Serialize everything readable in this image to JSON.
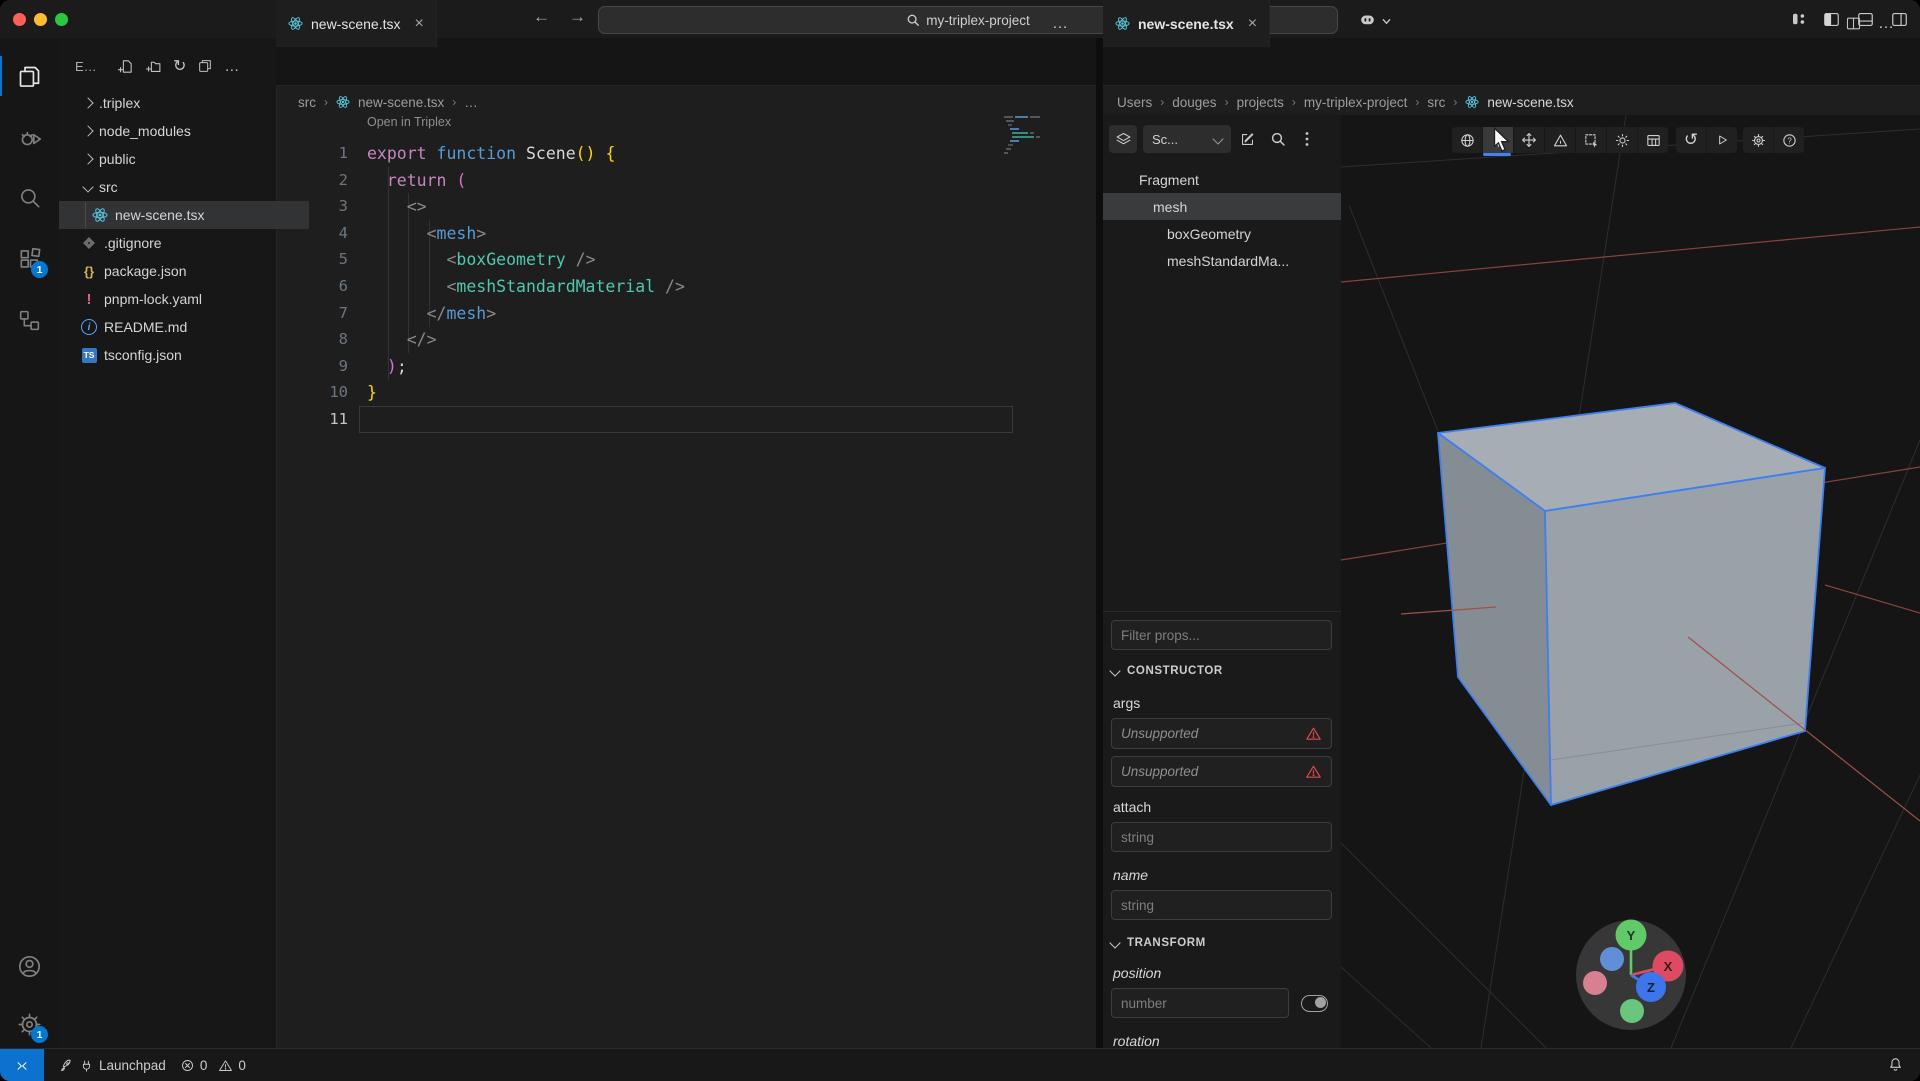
{
  "colors": {
    "accent_blue": "#0078d4",
    "selection_outline": "#3d7ff2",
    "badge_blue": "#0078d4",
    "error_red": "#e5484d",
    "react_cyan": "#58c4dc"
  },
  "titlebar": {
    "project_search": "my-triplex-project"
  },
  "activity_bar": {
    "extensions_badge": "1",
    "settings_badge": "1"
  },
  "explorer": {
    "title": "E…",
    "items": [
      {
        "label": ".triplex"
      },
      {
        "label": "node_modules"
      },
      {
        "label": "public"
      },
      {
        "label": "src"
      },
      {
        "label": "new-scene.tsx"
      },
      {
        "label": ".gitignore"
      },
      {
        "label": "package.json"
      },
      {
        "label": "pnpm-lock.yaml"
      },
      {
        "label": "README.md"
      },
      {
        "label": "tsconfig.json"
      }
    ],
    "ts_badge": "TS",
    "braces_glyph": "{}",
    "exclaim_glyph": "!",
    "info_glyph": "i"
  },
  "editor": {
    "tab_label": "new-scene.tsx",
    "breadcrumb": {
      "a": "src",
      "b": "new-scene.tsx",
      "c": "…"
    },
    "codelens": "Open in Triplex",
    "code": [
      {
        "n": "1",
        "t0": "export ",
        "t1": "function ",
        "t2": "Scene",
        "t3": "()",
        "t4": " ",
        "t5": "{"
      },
      {
        "n": "2",
        "t0": "  ",
        "t1": "return",
        "t2": " ",
        "t3": "("
      },
      {
        "n": "3",
        "t0": "    ",
        "t1": "<>"
      },
      {
        "n": "4",
        "t0": "      ",
        "t1": "<",
        "t2": "mesh",
        "t3": ">"
      },
      {
        "n": "5",
        "t0": "        ",
        "t1": "<",
        "t2": "boxGeometry",
        "t3": " ",
        "t4": "/>"
      },
      {
        "n": "6",
        "t0": "        ",
        "t1": "<",
        "t2": "meshStandardMaterial",
        "t3": " ",
        "t4": "/>"
      },
      {
        "n": "7",
        "t0": "      ",
        "t1": "</",
        "t2": "mesh",
        "t3": ">"
      },
      {
        "n": "8",
        "t0": "    ",
        "t1": "</>"
      },
      {
        "n": "9",
        "t0": "  ",
        "t1": ")",
        "t2": ";"
      },
      {
        "n": "10",
        "t0": "}"
      },
      {
        "n": "11",
        "t0": ""
      }
    ]
  },
  "triplex": {
    "tab_label": "new-scene.tsx",
    "breadcrumb": [
      "Users",
      "douges",
      "projects",
      "my-triplex-project",
      "src",
      "new-scene.tsx"
    ],
    "scene_select": "Sc...",
    "tree": [
      {
        "label": "Fragment"
      },
      {
        "label": "mesh"
      },
      {
        "label": "boxGeometry"
      },
      {
        "label": "meshStandardMa..."
      }
    ],
    "props": {
      "filter_placeholder": "Filter props...",
      "constructor_title": "CONSTRUCTOR",
      "args_label": "args",
      "unsupported": "Unsupported",
      "unsupported2": "Unsupported",
      "attach_label": "attach",
      "attach_placeholder": "string",
      "name_label": "name",
      "name_placeholder": "string",
      "transform_title": "TRANSFORM",
      "position_label": "position",
      "position_placeholder": "number",
      "rotation_label": "rotation"
    },
    "gizmo": {
      "x": "X",
      "y": "Y",
      "z": "Z"
    }
  },
  "statusbar": {
    "launchpad": "Launchpad",
    "errors": "0",
    "warnings": "0"
  }
}
